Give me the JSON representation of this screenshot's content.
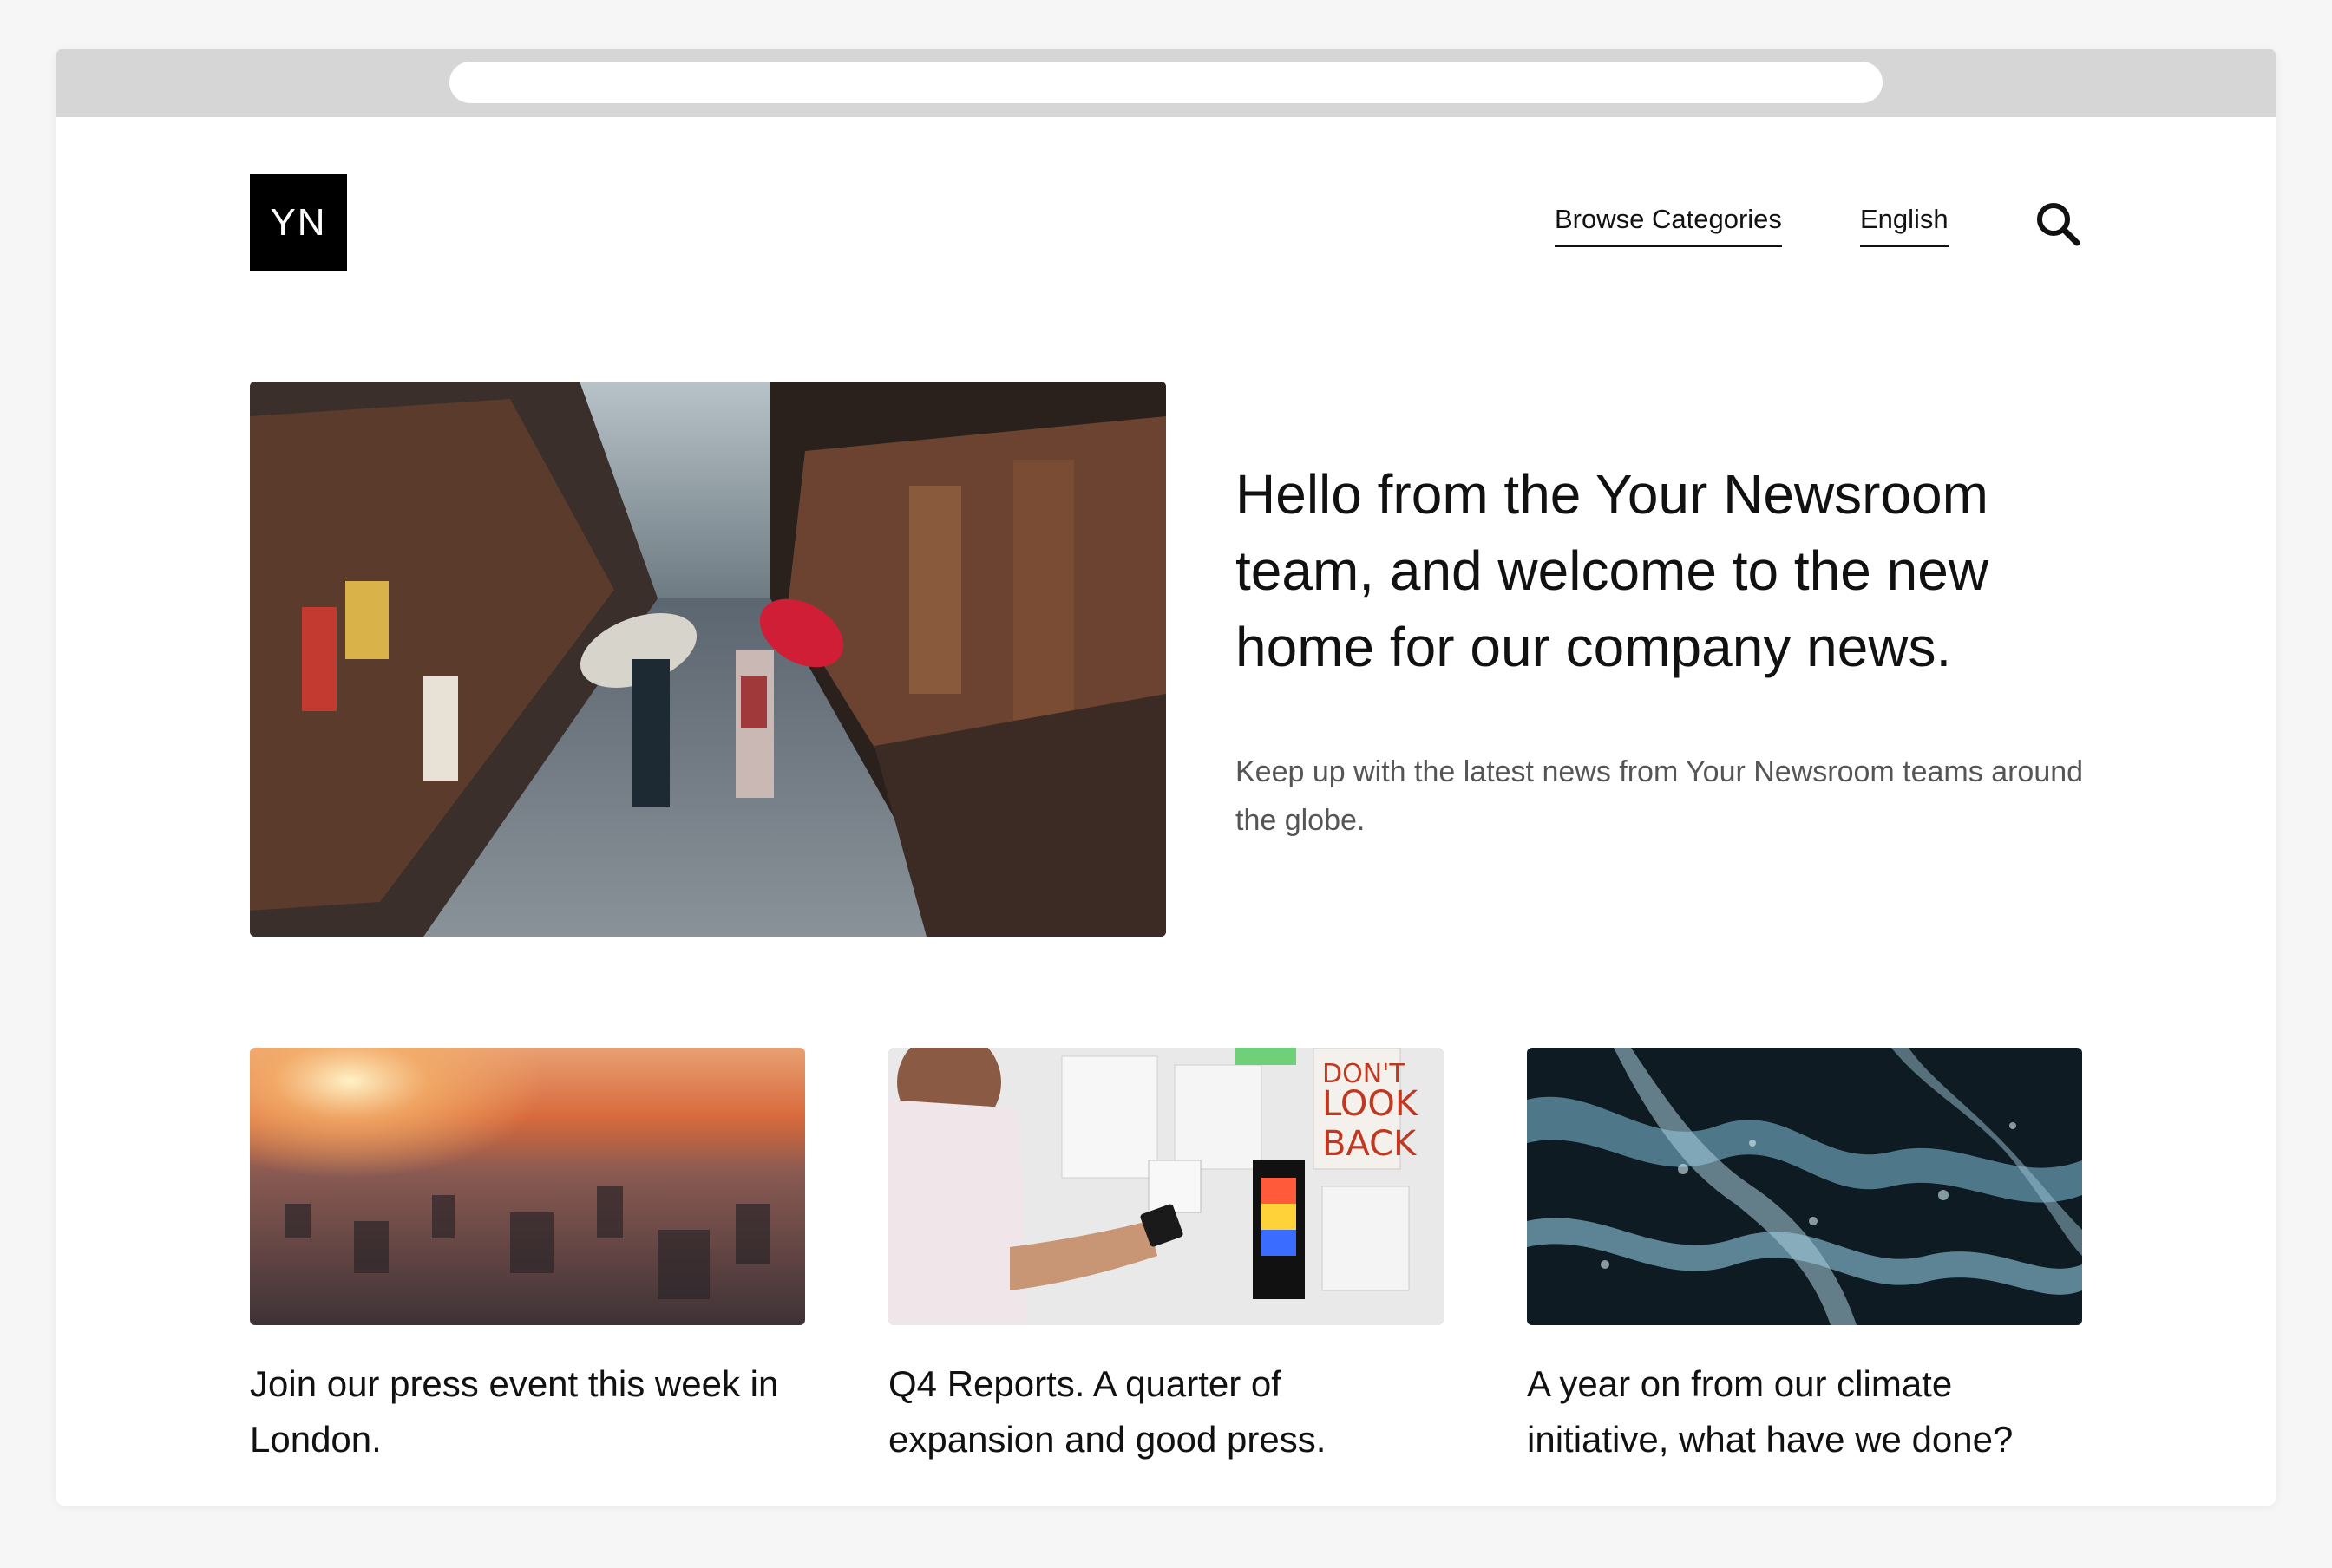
{
  "header": {
    "logo_text": "YN",
    "nav": {
      "categories_label": "Browse Categories",
      "language_label": "English"
    },
    "search_icon": "search-icon"
  },
  "hero": {
    "image": "street-photo",
    "title": "Hello from the Your Newsroom team, and welcome to the new home for our company news.",
    "subtitle": "Keep up with the latest news from Your Newsroom teams around the globe."
  },
  "cards": [
    {
      "image": "city-sunset-photo",
      "title": "Join our press event this week in London."
    },
    {
      "image": "office-phone-photo",
      "title": "Q4 Reports. A quarter of expansion and good press."
    },
    {
      "image": "ocean-waves-photo",
      "title": "A year on from our climate initiative, what have we done?"
    }
  ],
  "office_poster_text": [
    "DON'T",
    "LOOK",
    "BACK"
  ],
  "colors": {
    "accent": "#000000",
    "chrome": "#d6d6d6",
    "text": "#111111",
    "muted_text": "#555555"
  }
}
